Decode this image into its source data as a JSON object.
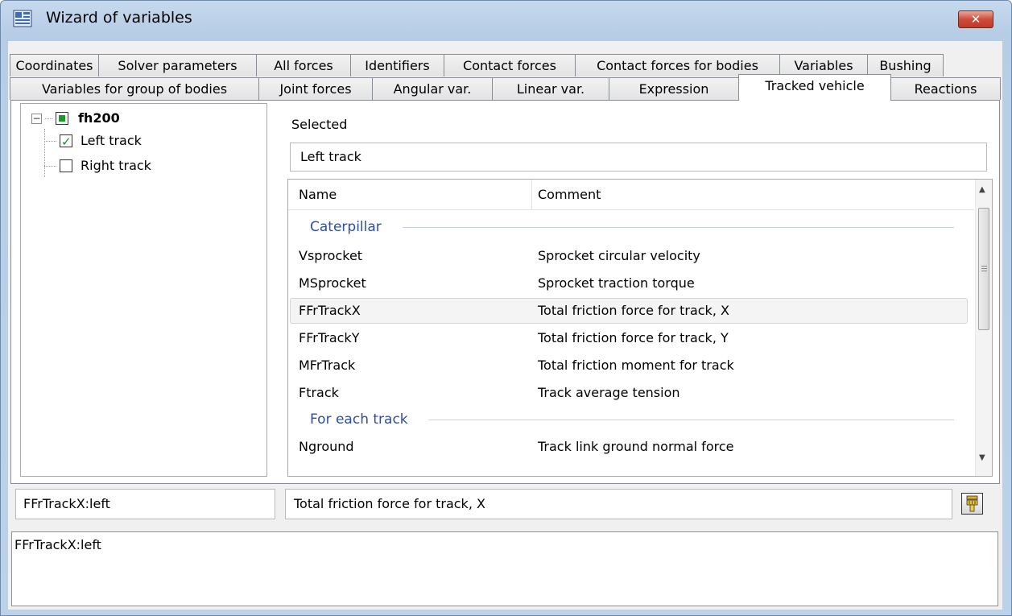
{
  "window": {
    "title": "Wizard of variables",
    "close_glyph": "✕"
  },
  "tabs_row1": [
    "Coordinates",
    "Solver parameters",
    "All forces",
    "Identifiers",
    "Contact forces",
    "Contact forces for bodies",
    "Variables",
    "Bushing"
  ],
  "tabs_row2": [
    "Variables for group of bodies",
    "Joint forces",
    "Angular var.",
    "Linear var.",
    "Expression",
    "Tracked vehicle",
    "Reactions"
  ],
  "active_tab": "Tracked vehicle",
  "tree": {
    "root": {
      "label": "fh200",
      "expander": "⊟"
    },
    "children": [
      {
        "label": "Left track",
        "checked": true
      },
      {
        "label": "Right track",
        "checked": false
      }
    ]
  },
  "selected": {
    "label": "Selected",
    "value": "Left track"
  },
  "list": {
    "columns": [
      "Name",
      "Comment"
    ],
    "rows": [
      {
        "type": "group",
        "name": "Caterpillar"
      },
      {
        "type": "item",
        "name": "Vsprocket",
        "comment": "Sprocket circular velocity"
      },
      {
        "type": "item",
        "name": "MSprocket",
        "comment": "Sprocket traction torque"
      },
      {
        "type": "item",
        "name": "FFrTrackX",
        "comment": "Total friction force for track, X",
        "selected": true
      },
      {
        "type": "item",
        "name": "FFrTrackY",
        "comment": "Total friction force for track, Y"
      },
      {
        "type": "item",
        "name": "MFrTrack",
        "comment": "Total friction moment for track"
      },
      {
        "type": "item",
        "name": "Ftrack",
        "comment": "Track average tension"
      },
      {
        "type": "group",
        "name": "For each track"
      },
      {
        "type": "item",
        "name": "Nground",
        "comment": "Track link ground normal force"
      }
    ]
  },
  "bottom": {
    "variable_name": "FFrTrackX:left",
    "variable_comment": "Total friction force for track, X",
    "expression": "FFrTrackX:left"
  },
  "colors": {
    "group_text": "#2b4fa6",
    "check_green": "#1a9a2a",
    "close_red": "#c03a28"
  }
}
